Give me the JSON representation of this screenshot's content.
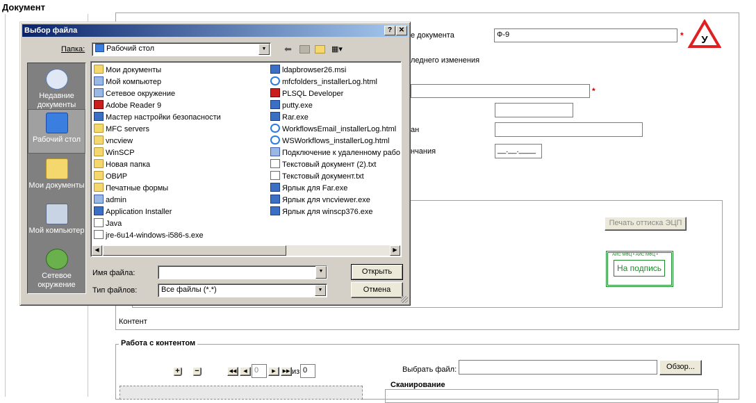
{
  "page": {
    "title": "Документ",
    "form": {
      "doc_name_label": "е документа",
      "doc_name_value": "Ф-9",
      "last_change_label": "леднего изменения",
      "issued_label": "ан",
      "end_label": "нчания",
      "date_placeholder": "__.__.____",
      "sign_print_button": "Печать оттиска ЭЦП",
      "stamp_text": "На подпись",
      "stamp_border_text": "АИС МФЦ • АИС МФЦ •",
      "content_label": "Контент"
    },
    "content_work": {
      "legend": "Работа с контентом",
      "zoom_in": "+",
      "zoom_out": "−",
      "page_value": "0",
      "of_label": "из",
      "total_pages": "0",
      "choose_file_label": "Выбрать файл:",
      "browse_button": "Обзор...",
      "scan_legend": "Сканирование"
    },
    "badge_letter": "У",
    "required_mark": "*"
  },
  "dialog": {
    "title": "Выбор файла",
    "help_btn": "?",
    "close_btn": "✕",
    "folder_label": "Папка:",
    "folder_value": "Рабочий стол",
    "places": [
      {
        "label": "Недавние документы"
      },
      {
        "label": "Рабочий стол"
      },
      {
        "label": "Мои документы"
      },
      {
        "label": "Мой компьютер"
      },
      {
        "label": "Сетевое окружение"
      }
    ],
    "files_col1": [
      {
        "name": "Мои документы",
        "icon": "folder"
      },
      {
        "name": "Мой компьютер",
        "icon": "sys"
      },
      {
        "name": "Сетевое окружение",
        "icon": "sys"
      },
      {
        "name": "Adobe Reader 9",
        "icon": "red"
      },
      {
        "name": "Мастер настройки безопасности",
        "icon": "exe"
      },
      {
        "name": "MFC servers",
        "icon": "folder"
      },
      {
        "name": "vncview",
        "icon": "folder"
      },
      {
        "name": "WinSCP",
        "icon": "folder"
      },
      {
        "name": "Новая папка",
        "icon": "folder"
      },
      {
        "name": "ОВИР",
        "icon": "folder"
      },
      {
        "name": "Печатные формы",
        "icon": "folder"
      },
      {
        "name": "admin",
        "icon": "sys"
      },
      {
        "name": "Application Installer",
        "icon": "exe"
      },
      {
        "name": "Java",
        "icon": "doc"
      },
      {
        "name": "jre-6u14-windows-i586-s.exe",
        "icon": "doc"
      }
    ],
    "files_col2": [
      {
        "name": "ldapbrowser26.msi",
        "icon": "exe"
      },
      {
        "name": "mfcfolders_installerLog.html",
        "icon": "html"
      },
      {
        "name": "PLSQL Developer",
        "icon": "red"
      },
      {
        "name": "putty.exe",
        "icon": "exe"
      },
      {
        "name": "Rar.exe",
        "icon": "exe"
      },
      {
        "name": "WorkflowsEmail_installerLog.html",
        "icon": "html"
      },
      {
        "name": "WSWorkflows_installerLog.html",
        "icon": "html"
      },
      {
        "name": "Подключение к удаленному рабо",
        "icon": "sys"
      },
      {
        "name": "Текстовый документ (2).txt",
        "icon": "doc"
      },
      {
        "name": "Текстовый документ.txt",
        "icon": "doc"
      },
      {
        "name": "Ярлык для Far.exe",
        "icon": "exe"
      },
      {
        "name": "Ярлык для vncviewer.exe",
        "icon": "exe"
      },
      {
        "name": "Ярлык для winscp376.exe",
        "icon": "exe"
      }
    ],
    "filename_label": "Имя файла:",
    "filename_value": "",
    "filetype_label": "Тип файлов:",
    "filetype_value": "Все файлы (*.*)",
    "open_button": "Открыть",
    "cancel_button": "Отмена"
  }
}
